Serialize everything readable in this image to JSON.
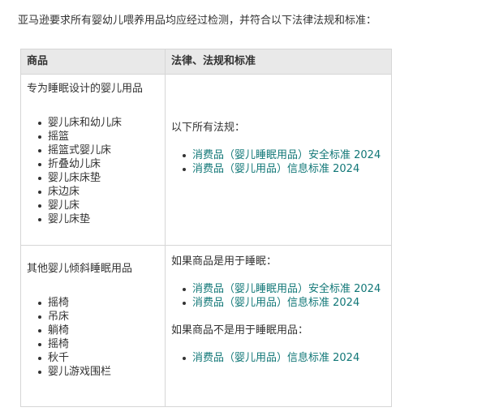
{
  "intro": "亚马逊要求所有婴幼儿喂养用品均应经过检测，并符合以下法律法规和标准：",
  "table": {
    "headers": [
      "商品",
      "法律、法规和标准"
    ],
    "rows": [
      {
        "product_title": "专为睡眠设计的婴儿用品",
        "products": [
          "婴儿床和幼儿床",
          "摇篮",
          "摇篮式婴儿床",
          "折叠幼儿床",
          "婴儿床床垫",
          "床边床",
          "婴儿床",
          "婴儿床垫"
        ],
        "law_groups": [
          {
            "heading": "以下所有法规：",
            "links": [
              "消费品（婴儿睡眠用品）安全标准 2024",
              "消费品（婴儿用品）信息标准 2024"
            ]
          }
        ]
      },
      {
        "product_title": "其他婴儿倾斜睡眠用品",
        "products": [
          "摇椅",
          "吊床",
          "躺椅",
          "摇椅",
          "秋千",
          "婴儿游戏围栏"
        ],
        "law_groups": [
          {
            "heading": "如果商品是用于睡眠：",
            "links": [
              "消费品（婴儿睡眠用品）安全标准 2024",
              "消费品（婴儿用品）信息标准 2024"
            ]
          },
          {
            "heading": "如果商品不是用于睡眠用品：",
            "links": [
              "消费品（婴儿用品）信息标准 2024"
            ]
          }
        ]
      }
    ]
  },
  "colors": {
    "link": "#117777",
    "header_bg": "#e9e9e9",
    "border": "#d6d6d6",
    "text": "#333333"
  }
}
